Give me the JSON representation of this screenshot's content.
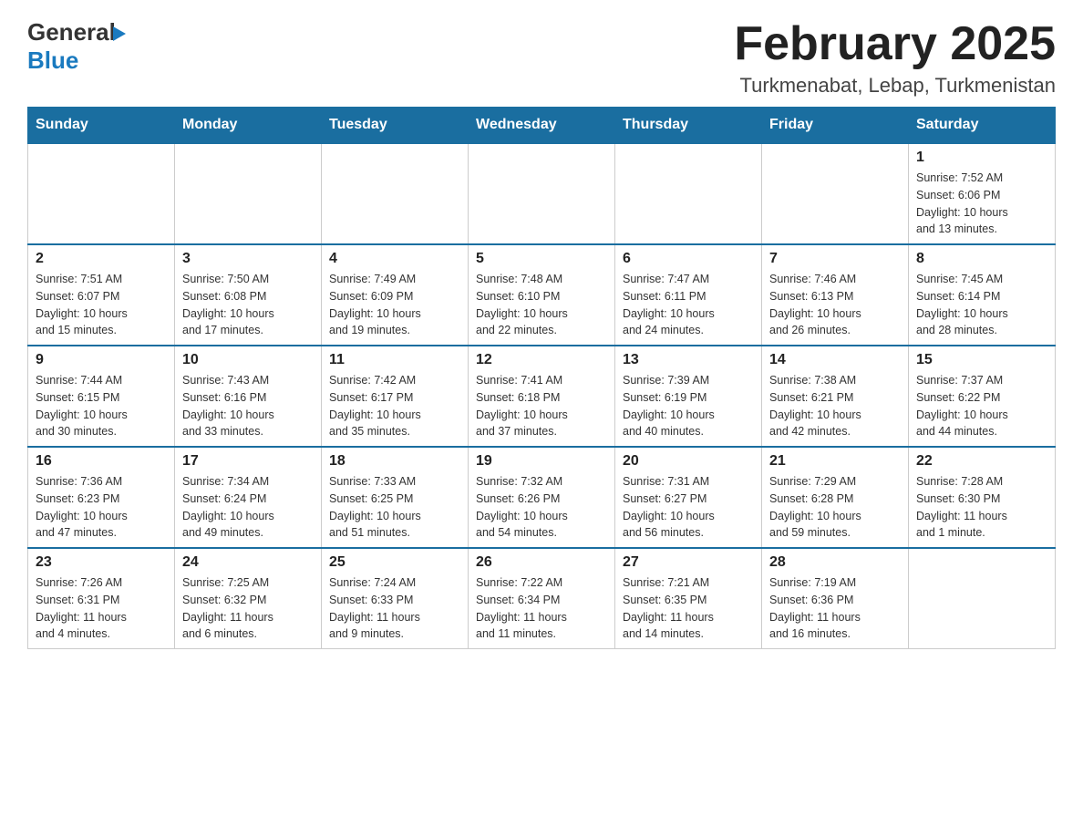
{
  "header": {
    "logo_general": "General",
    "logo_blue": "Blue",
    "month_title": "February 2025",
    "location": "Turkmenabat, Lebap, Turkmenistan"
  },
  "weekdays": [
    "Sunday",
    "Monday",
    "Tuesday",
    "Wednesday",
    "Thursday",
    "Friday",
    "Saturday"
  ],
  "weeks": [
    [
      {
        "day": "",
        "info": ""
      },
      {
        "day": "",
        "info": ""
      },
      {
        "day": "",
        "info": ""
      },
      {
        "day": "",
        "info": ""
      },
      {
        "day": "",
        "info": ""
      },
      {
        "day": "",
        "info": ""
      },
      {
        "day": "1",
        "info": "Sunrise: 7:52 AM\nSunset: 6:06 PM\nDaylight: 10 hours\nand 13 minutes."
      }
    ],
    [
      {
        "day": "2",
        "info": "Sunrise: 7:51 AM\nSunset: 6:07 PM\nDaylight: 10 hours\nand 15 minutes."
      },
      {
        "day": "3",
        "info": "Sunrise: 7:50 AM\nSunset: 6:08 PM\nDaylight: 10 hours\nand 17 minutes."
      },
      {
        "day": "4",
        "info": "Sunrise: 7:49 AM\nSunset: 6:09 PM\nDaylight: 10 hours\nand 19 minutes."
      },
      {
        "day": "5",
        "info": "Sunrise: 7:48 AM\nSunset: 6:10 PM\nDaylight: 10 hours\nand 22 minutes."
      },
      {
        "day": "6",
        "info": "Sunrise: 7:47 AM\nSunset: 6:11 PM\nDaylight: 10 hours\nand 24 minutes."
      },
      {
        "day": "7",
        "info": "Sunrise: 7:46 AM\nSunset: 6:13 PM\nDaylight: 10 hours\nand 26 minutes."
      },
      {
        "day": "8",
        "info": "Sunrise: 7:45 AM\nSunset: 6:14 PM\nDaylight: 10 hours\nand 28 minutes."
      }
    ],
    [
      {
        "day": "9",
        "info": "Sunrise: 7:44 AM\nSunset: 6:15 PM\nDaylight: 10 hours\nand 30 minutes."
      },
      {
        "day": "10",
        "info": "Sunrise: 7:43 AM\nSunset: 6:16 PM\nDaylight: 10 hours\nand 33 minutes."
      },
      {
        "day": "11",
        "info": "Sunrise: 7:42 AM\nSunset: 6:17 PM\nDaylight: 10 hours\nand 35 minutes."
      },
      {
        "day": "12",
        "info": "Sunrise: 7:41 AM\nSunset: 6:18 PM\nDaylight: 10 hours\nand 37 minutes."
      },
      {
        "day": "13",
        "info": "Sunrise: 7:39 AM\nSunset: 6:19 PM\nDaylight: 10 hours\nand 40 minutes."
      },
      {
        "day": "14",
        "info": "Sunrise: 7:38 AM\nSunset: 6:21 PM\nDaylight: 10 hours\nand 42 minutes."
      },
      {
        "day": "15",
        "info": "Sunrise: 7:37 AM\nSunset: 6:22 PM\nDaylight: 10 hours\nand 44 minutes."
      }
    ],
    [
      {
        "day": "16",
        "info": "Sunrise: 7:36 AM\nSunset: 6:23 PM\nDaylight: 10 hours\nand 47 minutes."
      },
      {
        "day": "17",
        "info": "Sunrise: 7:34 AM\nSunset: 6:24 PM\nDaylight: 10 hours\nand 49 minutes."
      },
      {
        "day": "18",
        "info": "Sunrise: 7:33 AM\nSunset: 6:25 PM\nDaylight: 10 hours\nand 51 minutes."
      },
      {
        "day": "19",
        "info": "Sunrise: 7:32 AM\nSunset: 6:26 PM\nDaylight: 10 hours\nand 54 minutes."
      },
      {
        "day": "20",
        "info": "Sunrise: 7:31 AM\nSunset: 6:27 PM\nDaylight: 10 hours\nand 56 minutes."
      },
      {
        "day": "21",
        "info": "Sunrise: 7:29 AM\nSunset: 6:28 PM\nDaylight: 10 hours\nand 59 minutes."
      },
      {
        "day": "22",
        "info": "Sunrise: 7:28 AM\nSunset: 6:30 PM\nDaylight: 11 hours\nand 1 minute."
      }
    ],
    [
      {
        "day": "23",
        "info": "Sunrise: 7:26 AM\nSunset: 6:31 PM\nDaylight: 11 hours\nand 4 minutes."
      },
      {
        "day": "24",
        "info": "Sunrise: 7:25 AM\nSunset: 6:32 PM\nDaylight: 11 hours\nand 6 minutes."
      },
      {
        "day": "25",
        "info": "Sunrise: 7:24 AM\nSunset: 6:33 PM\nDaylight: 11 hours\nand 9 minutes."
      },
      {
        "day": "26",
        "info": "Sunrise: 7:22 AM\nSunset: 6:34 PM\nDaylight: 11 hours\nand 11 minutes."
      },
      {
        "day": "27",
        "info": "Sunrise: 7:21 AM\nSunset: 6:35 PM\nDaylight: 11 hours\nand 14 minutes."
      },
      {
        "day": "28",
        "info": "Sunrise: 7:19 AM\nSunset: 6:36 PM\nDaylight: 11 hours\nand 16 minutes."
      },
      {
        "day": "",
        "info": ""
      }
    ]
  ]
}
